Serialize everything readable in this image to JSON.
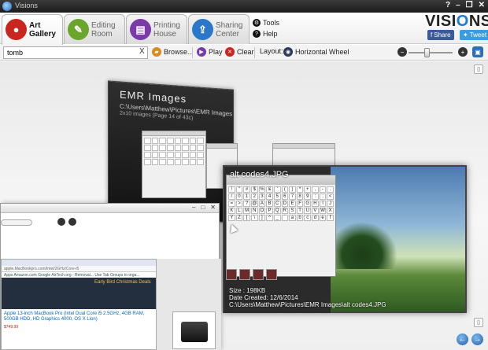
{
  "titlebar": {
    "title": "Visions",
    "controls": [
      "?",
      "–",
      "❐",
      "✕"
    ]
  },
  "tabs": [
    {
      "label": "Art Gallery",
      "icon": "art-gallery-icon",
      "color": "#c8261e",
      "active": true
    },
    {
      "label": "Editing Room",
      "icon": "editing-room-icon",
      "color": "#6aa62c",
      "active": false
    },
    {
      "label": "Printing House",
      "icon": "printing-house-icon",
      "color": "#7a3aa8",
      "active": false
    },
    {
      "label": "Sharing Center",
      "icon": "sharing-center-icon",
      "color": "#2b78c8",
      "active": false
    }
  ],
  "tools": {
    "tools_label": "Tools",
    "help_label": "Help"
  },
  "brand": {
    "logo_pre": "VISI",
    "logo_o": "O",
    "logo_post": "NS",
    "share_label": "Share",
    "tweet_label": "Tweet",
    "accent": "#1e7ad6"
  },
  "toolbar": {
    "search_value": "tomb",
    "browse_label": "Browse...",
    "play_label": "Play",
    "clear_label": "Clear",
    "layout_label": "Layout:",
    "layout_value": "Horizontal Wheel",
    "zoom_level": 0.4
  },
  "folder": {
    "title": "EMR Images",
    "path": "C:\\Users\\Matthew\\Pictures\\EMR Images",
    "count": "2x10 images (Page 14 of 43c)"
  },
  "preview": {
    "filename": "alt codes4.JPG",
    "size": "Size : 198KB",
    "created": "Date Created: 12/6/2014",
    "path": "C:\\Users\\Matthew\\Pictures\\EMR Images\\alt codes4.JPG",
    "dialog_keys": [
      "!",
      "\"",
      "#",
      "$",
      "%",
      "&",
      "'",
      "(",
      ")",
      "*",
      "+",
      ",",
      "-",
      ".",
      "/",
      "0",
      "1",
      "2",
      "3",
      "4",
      "5",
      "6",
      "7",
      "8",
      "9",
      ":",
      ";",
      "<",
      "=",
      ">",
      "?",
      "@",
      "A",
      "B",
      "C",
      "D",
      "E",
      "F",
      "G",
      "H",
      "I",
      "J",
      "K",
      "L",
      "M",
      "N",
      "O",
      "P",
      "Q",
      "R",
      "S",
      "T",
      "U",
      "V",
      "W",
      "X",
      "Y",
      "Z",
      "[",
      "\\",
      "]",
      "^",
      "_",
      "`",
      "a",
      "b",
      "c",
      "d",
      "e",
      "f"
    ]
  },
  "browser_thumb": {
    "url": "apple.MacBookpro.com/Intel/2GHz/Core-i5",
    "bookmarks": "Apps  Amazon.com  Google  AirTech.org - Removal...  Use Tab Groups to orga...  Chrome Web Store - E...",
    "christmas": "Early Bird Christmas Deals",
    "title": "Apple 13-inch MacBook Pro (Intel Dual Core i5 2.5GHz, 4GB RAM, 500GB HDD, HD Graphics 4000, OS X Lion)",
    "price": "$749.99"
  }
}
